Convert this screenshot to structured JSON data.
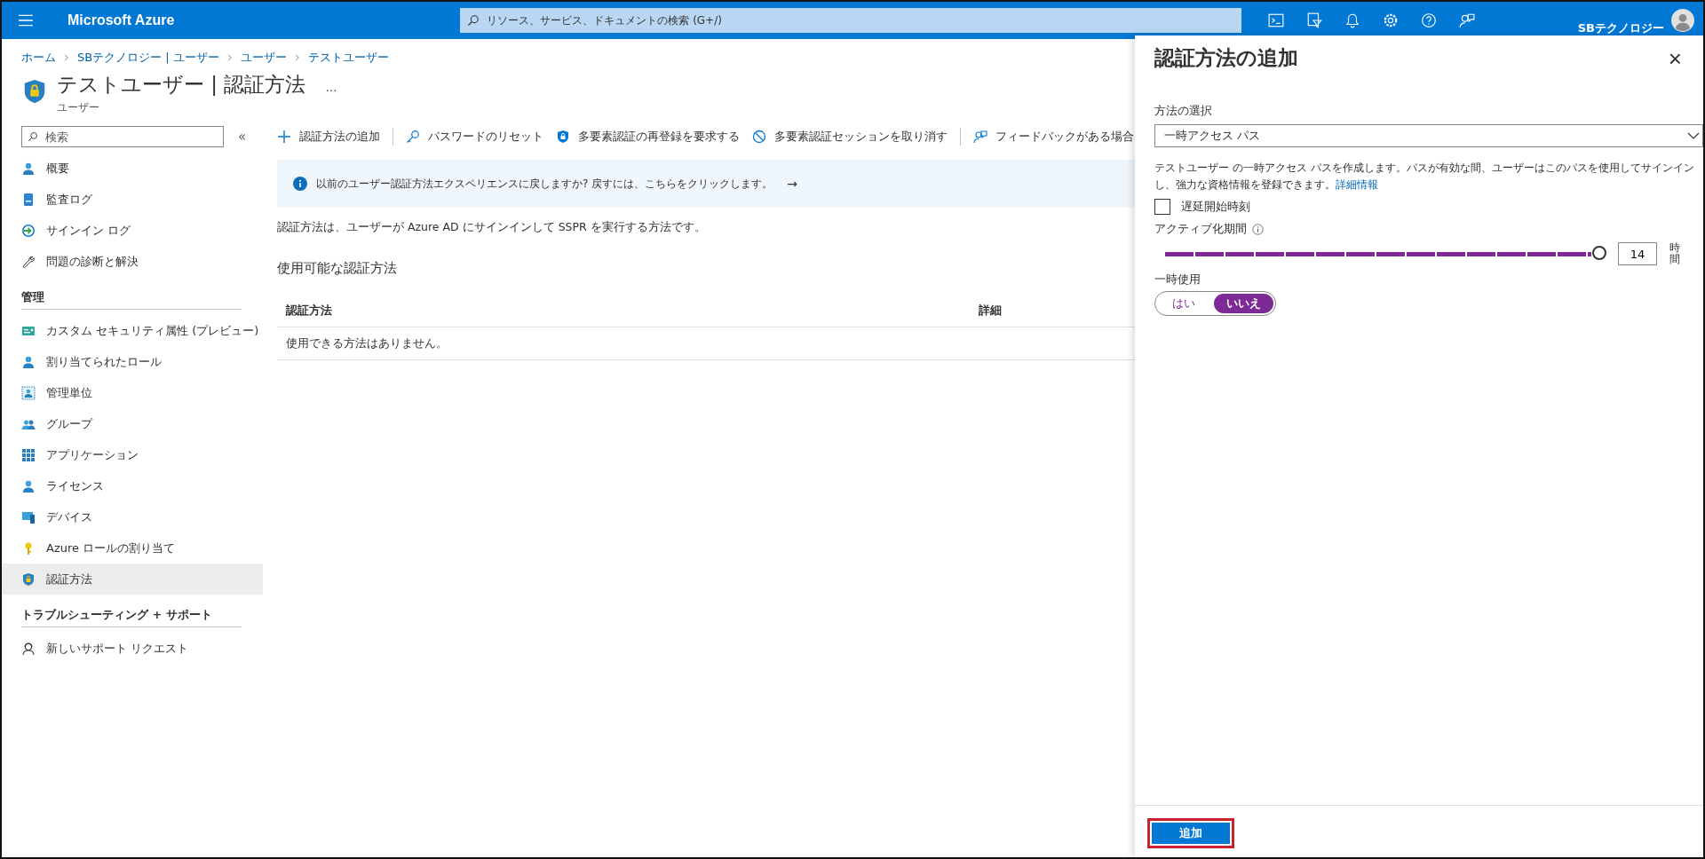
{
  "topbar": {
    "brand": "Microsoft Azure",
    "search": {
      "placeholder": "リソース、サービス、ドキュメントの検索 (G+/)"
    },
    "org": "SBテクノロジー"
  },
  "breadcrumb": [
    "ホーム",
    "SBテクノロジー | ユーザー",
    "ユーザー",
    "テストユーザー"
  ],
  "page": {
    "title": "テストユーザー | 認証方法",
    "more": "...",
    "subtitle": "ユーザー"
  },
  "sidebar": {
    "search": {
      "placeholder": "検索"
    },
    "collapse": "«",
    "sections": [
      {
        "items": [
          {
            "label": "概要",
            "kind": "person",
            "selected": false
          },
          {
            "label": "監査ログ",
            "kind": "book",
            "selected": false
          },
          {
            "label": "サインイン ログ",
            "kind": "signin",
            "selected": false
          },
          {
            "label": "問題の診断と解決",
            "kind": "wrench",
            "selected": false
          }
        ]
      },
      {
        "title": "管理",
        "items": [
          {
            "label": "カスタム セキュリティ属性 (プレビュー)",
            "kind": "card",
            "selected": false
          },
          {
            "label": "割り当てられたロール",
            "kind": "person",
            "selected": false
          },
          {
            "label": "管理単位",
            "kind": "unit",
            "selected": false
          },
          {
            "label": "グループ",
            "kind": "group",
            "selected": false
          },
          {
            "label": "アプリケーション",
            "kind": "grid",
            "selected": false
          },
          {
            "label": "ライセンス",
            "kind": "person",
            "selected": false
          },
          {
            "label": "デバイス",
            "kind": "device",
            "selected": false
          },
          {
            "label": "Azure ロールの割り当て",
            "kind": "key",
            "selected": false
          },
          {
            "label": "認証方法",
            "kind": "shield",
            "selected": true
          }
        ]
      },
      {
        "title": "トラブルシューティング + サポート",
        "items": [
          {
            "label": "新しいサポート リクエスト",
            "kind": "support",
            "selected": false
          }
        ]
      }
    ]
  },
  "toolbar": [
    {
      "label": "認証方法の追加",
      "kind": "plus"
    },
    {
      "label": "パスワードのリセット",
      "kind": "key"
    },
    {
      "label": "多要素認証の再登録を要求する",
      "kind": "lock"
    },
    {
      "label": "多要素認証セッションを取り消す",
      "kind": "block"
    },
    {
      "label": "フィードバックがある場合",
      "kind": "feedback"
    }
  ],
  "banner": {
    "text": "以前のユーザー認証方法エクスペリエンスに戻しますか? 戻すには、こちらをクリックします。",
    "arrow": "→"
  },
  "description": "認証方法は、ユーザーが Azure AD にサインインして SSPR を実行する方法です。",
  "section_title": "使用可能な認証方法",
  "table": {
    "columns": [
      "認証方法",
      "詳細"
    ],
    "empty": "使用できる方法はありません。"
  },
  "panel": {
    "title": "認証方法の追加",
    "close": "×",
    "method": {
      "label": "方法の選択",
      "value": "一時アクセス パス"
    },
    "description": "テストユーザー の一時アクセス パスを作成します。パスが有効な間、ユーザーはこのパスを使用してサインインし、強力な資格情報を登録できます。",
    "link": "詳細情報",
    "delay": {
      "label": "遅延開始時刻",
      "checked": false
    },
    "activation": {
      "label": "アクティブ化期間",
      "level": 1,
      "value": "14",
      "unit": "時間"
    },
    "one_time": {
      "label": "一時使用",
      "options": [
        {
          "label": "はい",
          "selected": false
        },
        {
          "label": "いいえ",
          "selected": true
        }
      ]
    },
    "submit": "追加"
  }
}
